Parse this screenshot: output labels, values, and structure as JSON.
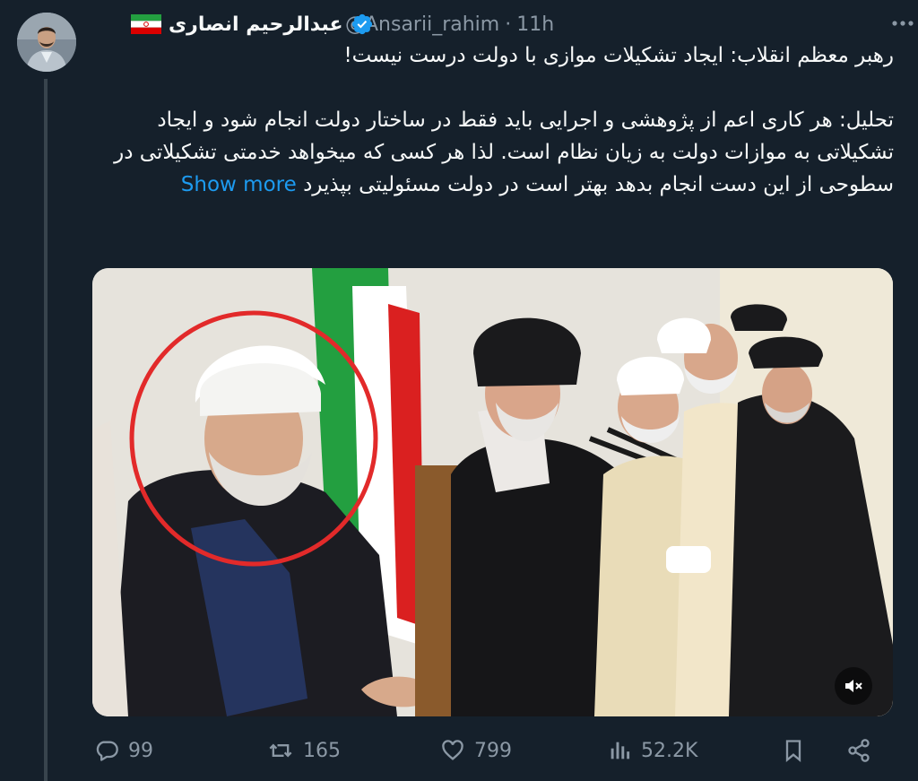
{
  "tweet": {
    "author_name": "عبدالرحیم انصاری",
    "handle": "@Ansarii_rahim",
    "separator": "·",
    "time": "11h",
    "line1": "رهبر معظم انقلاب: ایجاد تشکیلات موازی با دولت درست نیست!",
    "para2": "تحلیل: هر کاری اعم از پژوهشی و اجرایی باید فقط در ساختار دولت انجام شود و ایجاد تشکیلاتی به موازات دولت به زیان نظام است. لذا هر کسی که میخواهد خدمتی تشکیلاتی در سطوحی از این دست انجام بدهد بهتر است در دولت مسئولیتی بپذیرد",
    "show_more": "Show more"
  },
  "actions": {
    "replies": "99",
    "retweets": "165",
    "likes": "799",
    "views": "52.2K"
  },
  "colors": {
    "background": "#15202b",
    "accent": "#1d9bf0",
    "muted": "#8b98a5"
  },
  "icons": [
    "verified-icon",
    "iran-flag-icon",
    "more-icon",
    "reply-icon",
    "retweet-icon",
    "like-icon",
    "views-icon",
    "bookmark-icon",
    "share-icon",
    "mute-icon"
  ]
}
